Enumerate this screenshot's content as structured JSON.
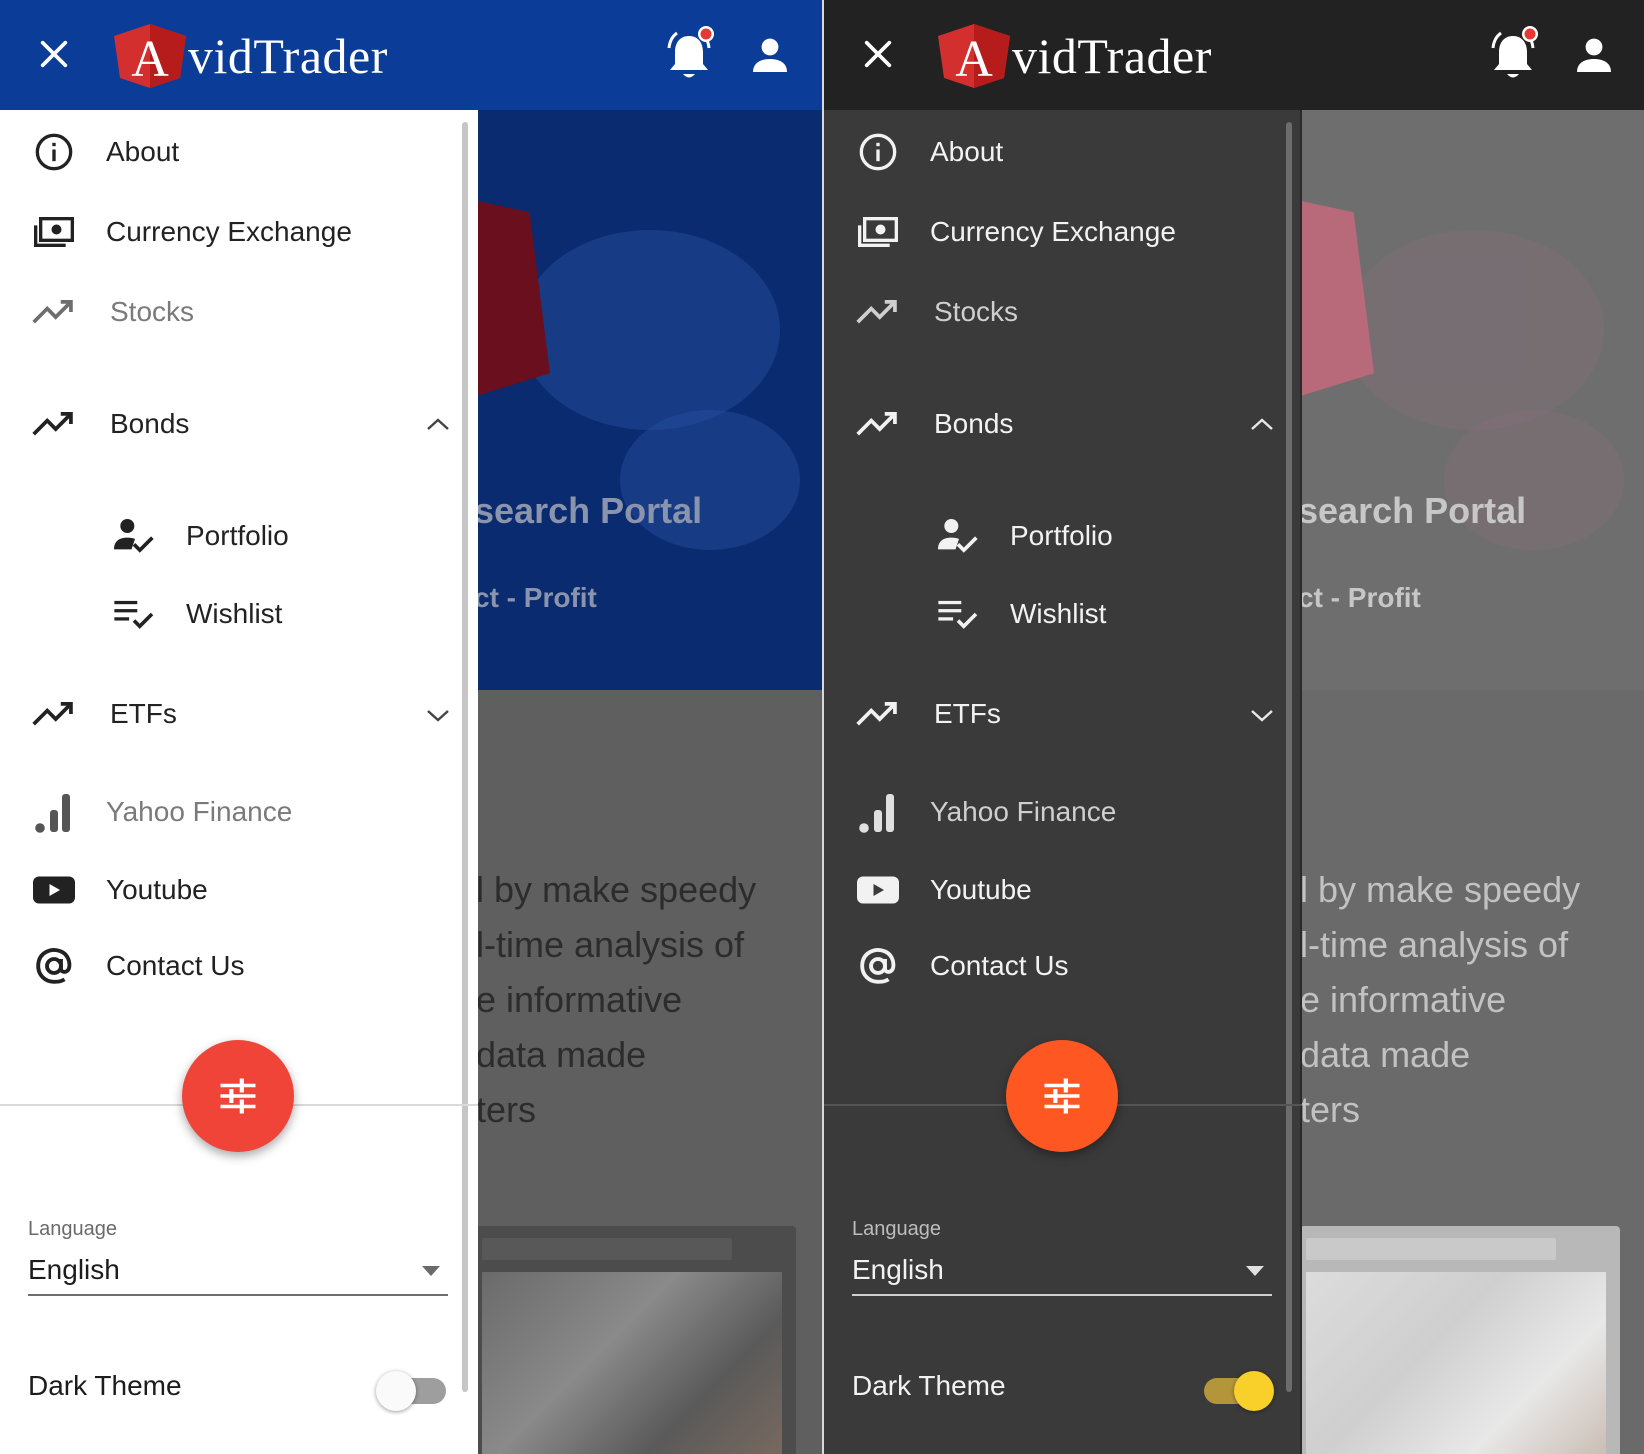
{
  "screens": [
    {
      "theme": "light",
      "toolbar": {
        "brand_initial": "A",
        "brand_rest": "vidTrader"
      },
      "background": {
        "hero_title": "search Portal",
        "hero_subtitle": "ct - Profit",
        "body_lines": [
          "l by make speedy",
          "l-time analysis of",
          "e informative",
          "data made",
          "ters"
        ]
      },
      "menu": [
        {
          "label": "About",
          "icon": "info-icon"
        },
        {
          "label": "Currency Exchange",
          "icon": "money-icon"
        },
        {
          "label": "Stocks",
          "icon": "trending-up-icon"
        },
        {
          "label": "Bonds",
          "icon": "trending-up-icon",
          "expanded": true
        },
        {
          "label": "Portfolio",
          "icon": "person-check-icon"
        },
        {
          "label": "Wishlist",
          "icon": "playlist-check-icon"
        },
        {
          "label": "ETFs",
          "icon": "trending-up-icon",
          "expanded": false
        },
        {
          "label": "Yahoo Finance",
          "icon": "signal-bars-icon"
        },
        {
          "label": "Youtube",
          "icon": "youtube-icon"
        },
        {
          "label": "Contact Us",
          "icon": "at-sign-icon"
        }
      ],
      "settings": {
        "language_label": "Language",
        "language_value": "English",
        "dark_theme_label": "Dark Theme",
        "dark_theme_on": false
      }
    },
    {
      "theme": "dark",
      "toolbar": {
        "brand_initial": "A",
        "brand_rest": "vidTrader"
      },
      "background": {
        "hero_title": "search Portal",
        "hero_subtitle": "ct - Profit",
        "body_lines": [
          "l by make speedy",
          "l-time analysis of",
          "e informative",
          "data made",
          "ters"
        ]
      },
      "menu": [
        {
          "label": "About",
          "icon": "info-icon"
        },
        {
          "label": "Currency Exchange",
          "icon": "money-icon"
        },
        {
          "label": "Stocks",
          "icon": "trending-up-icon"
        },
        {
          "label": "Bonds",
          "icon": "trending-up-icon",
          "expanded": true
        },
        {
          "label": "Portfolio",
          "icon": "person-check-icon"
        },
        {
          "label": "Wishlist",
          "icon": "playlist-check-icon"
        },
        {
          "label": "ETFs",
          "icon": "trending-up-icon",
          "expanded": false
        },
        {
          "label": "Yahoo Finance",
          "icon": "signal-bars-icon"
        },
        {
          "label": "Youtube",
          "icon": "youtube-icon"
        },
        {
          "label": "Contact Us",
          "icon": "at-sign-icon"
        }
      ],
      "settings": {
        "language_label": "Language",
        "language_value": "English",
        "dark_theme_label": "Dark Theme",
        "dark_theme_on": true
      }
    }
  ],
  "colors": {
    "light_toolbar": "#0b3c98",
    "dark_toolbar": "#222222",
    "fab_light": "#f04438",
    "fab_dark": "#ff5722",
    "notification_dot": "#e53935",
    "brand_red": "#d32f2f",
    "toggle_on": "#f9cf2a"
  }
}
